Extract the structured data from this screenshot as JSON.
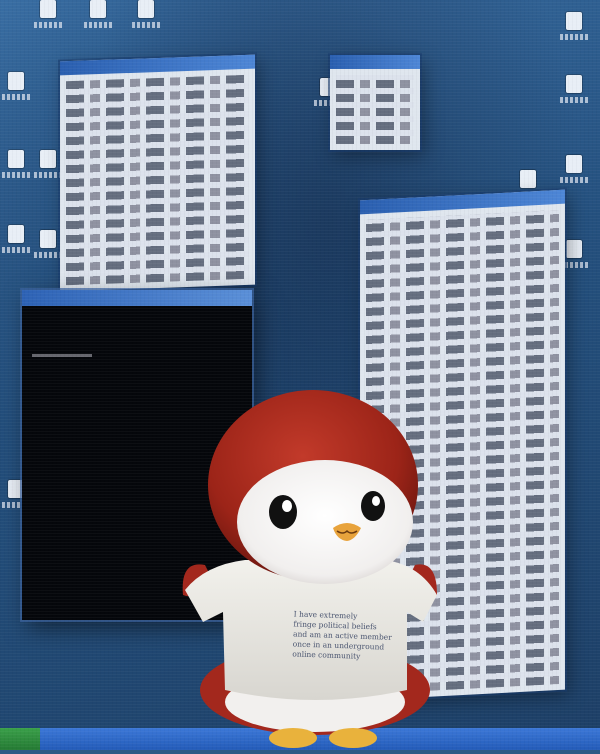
{
  "scene": {
    "description_role": "photo of plush penguin mascot in front of glitchy desktop screenshot",
    "colors": {
      "desktop_blue": "#2c5a86",
      "hood_red": "#a3281d",
      "shirt_white": "#ecebe6",
      "beak_orange": "#e8a33c",
      "feet_yellow": "#e9b23c"
    }
  },
  "background": {
    "icons": [
      "folder-icon",
      "document-icon",
      "app-icon"
    ],
    "windows": [
      "explorer-window",
      "explorer-window",
      "console-window"
    ]
  },
  "mascot": {
    "shirt_text": [
      "I have extremely",
      "fringe political beliefs",
      "and am an active member",
      "once in an underground",
      "online community"
    ]
  }
}
